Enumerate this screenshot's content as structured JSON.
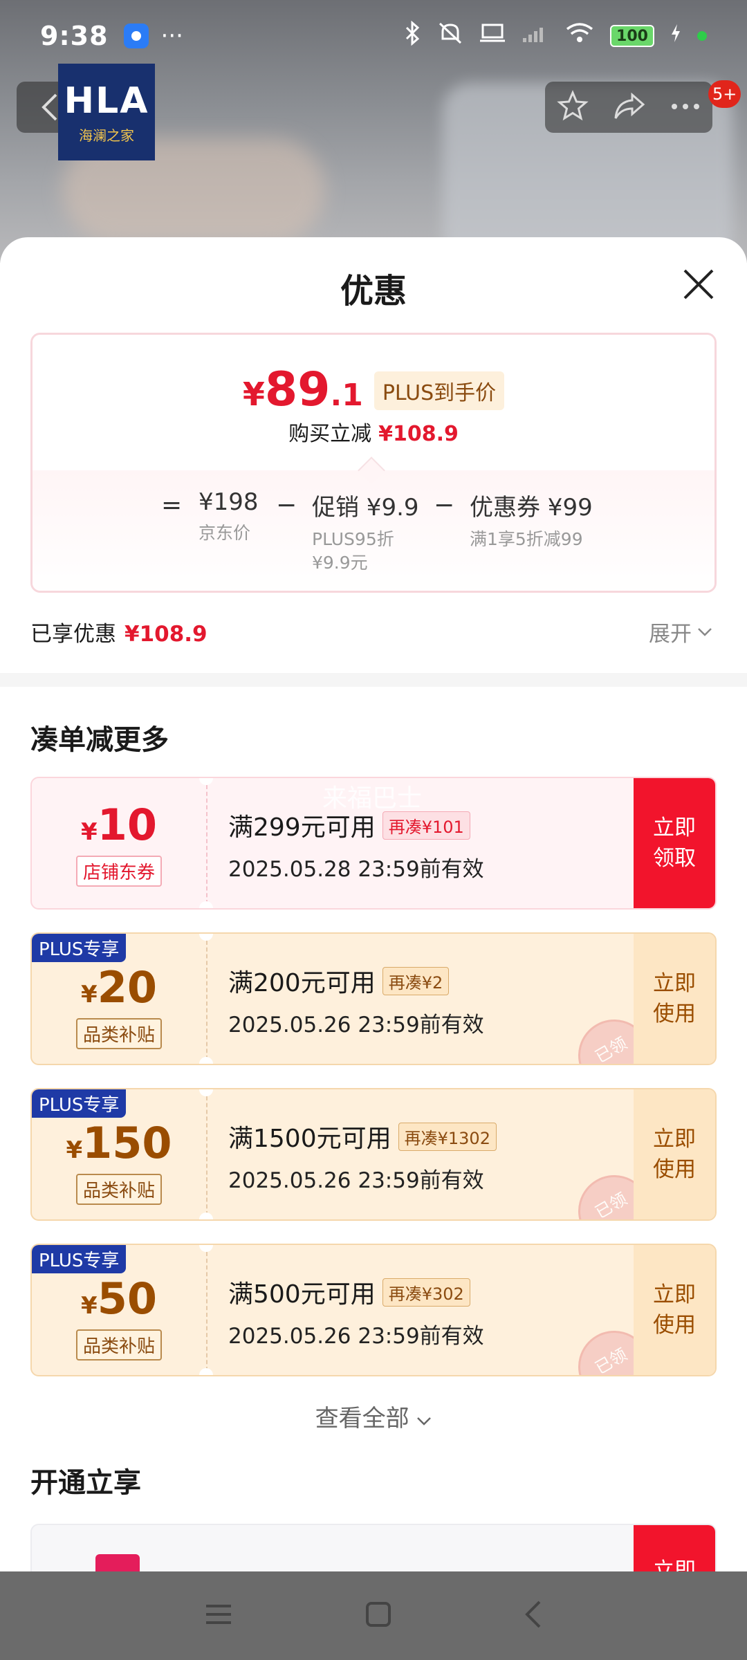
{
  "status_bar": {
    "time": "9:38",
    "more": "···",
    "battery": "100"
  },
  "brand": {
    "logo_text": "HLA",
    "logo_sub": "海澜之家"
  },
  "badge_count": "5+",
  "sheet": {
    "title": "优惠",
    "price": {
      "currency": "¥",
      "integer": "89",
      "decimal": ".1",
      "tag": "PLUS到手价"
    },
    "reduce": {
      "label": "购买立减",
      "value": "¥108.9"
    },
    "formula": {
      "eq": "=",
      "jd_price": "¥198",
      "jd_label": "京东价",
      "minus1": "−",
      "promo": "促销 ¥9.9",
      "promo_sub1": "PLUS95折",
      "promo_sub2": "¥9.9元",
      "minus2": "−",
      "coupon": "优惠券 ¥99",
      "coupon_sub": "满1享5折减99"
    },
    "enjoyed": {
      "label": "已享优惠",
      "value": "¥108.9"
    },
    "expand_label": "展开"
  },
  "section_more": "凑单减更多",
  "watermark": "来福巴士",
  "coupons": [
    {
      "currency": "¥",
      "amount": "10",
      "tag": "店铺东券",
      "condition": "满299元可用",
      "need": "再凑¥101",
      "date": "2025.05.28 23:59前有效",
      "action_1": "立即",
      "action_2": "领取",
      "plus": ""
    },
    {
      "currency": "¥",
      "amount": "20",
      "tag": "品类补贴",
      "condition": "满200元可用",
      "need": "再凑¥2",
      "date": "2025.05.26 23:59前有效",
      "action_1": "立即",
      "action_2": "使用",
      "plus": "PLUS专享",
      "stamp": "已领"
    },
    {
      "currency": "¥",
      "amount": "150",
      "tag": "品类补贴",
      "condition": "满1500元可用",
      "need": "再凑¥1302",
      "date": "2025.05.26 23:59前有效",
      "action_1": "立即",
      "action_2": "使用",
      "plus": "PLUS专享",
      "stamp": "已领"
    },
    {
      "currency": "¥",
      "amount": "50",
      "tag": "品类补贴",
      "condition": "满500元可用",
      "need": "再凑¥302",
      "date": "2025.05.26 23:59前有效",
      "action_1": "立即",
      "action_2": "使用",
      "plus": "PLUS专享",
      "stamp": "已领"
    }
  ],
  "view_all": "查看全部",
  "section_open": "开通立享",
  "open_card_action": "立即"
}
